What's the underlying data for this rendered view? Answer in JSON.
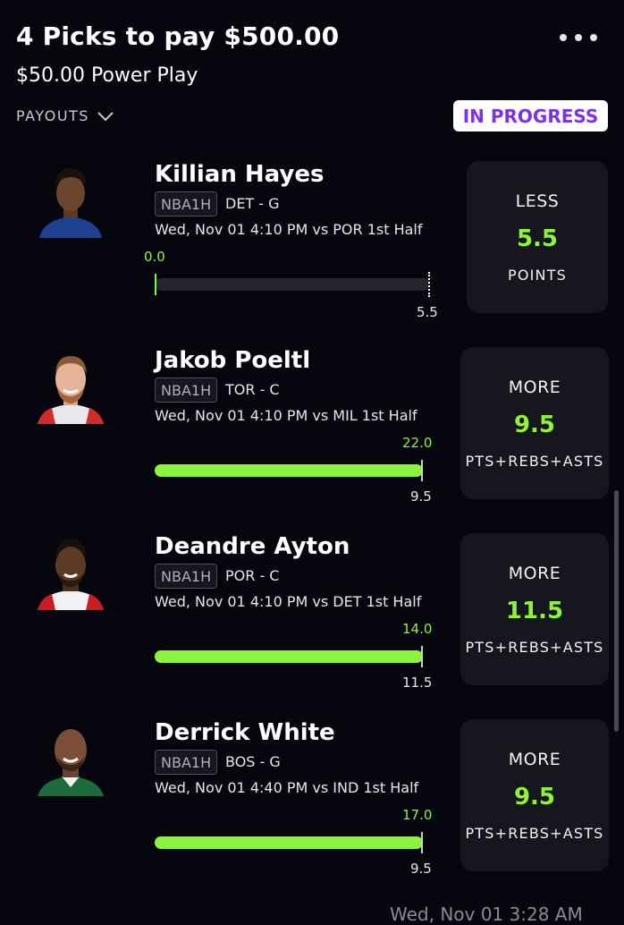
{
  "header": {
    "title": "4 Picks to pay $500.00",
    "subtitle": "$50.00 Power Play",
    "payouts_label": "PAYOUTS",
    "status": "IN PROGRESS"
  },
  "picks": [
    {
      "player": "Killian Hayes",
      "league": "NBA1H",
      "team_pos": "DET - G",
      "game": "Wed, Nov 01 4:10 PM  vs POR 1st Half",
      "current": "0.0",
      "line": "5.5",
      "progress": 0.0,
      "direction": "LESS",
      "stat": "POINTS"
    },
    {
      "player": "Jakob Poeltl",
      "league": "NBA1H",
      "team_pos": "TOR - C",
      "game": "Wed, Nov 01 4:10 PM  vs MIL 1st Half",
      "current": "22.0",
      "line": "9.5",
      "progress": 1.0,
      "direction": "MORE",
      "stat": "PTS+REBS+ASTS"
    },
    {
      "player": "Deandre Ayton",
      "league": "NBA1H",
      "team_pos": "POR - C",
      "game": "Wed, Nov 01 4:10 PM  vs DET 1st Half",
      "current": "14.0",
      "line": "11.5",
      "progress": 1.0,
      "direction": "MORE",
      "stat": "PTS+REBS+ASTS"
    },
    {
      "player": "Derrick White",
      "league": "NBA1H",
      "team_pos": "BOS - G",
      "game": "Wed, Nov 01 4:40 PM  vs IND 1st Half",
      "current": "17.0",
      "line": "9.5",
      "progress": 1.0,
      "direction": "MORE",
      "stat": "PTS+REBS+ASTS"
    }
  ],
  "footer": {
    "timestamp": "Wed, Nov 01 3:28 AM"
  },
  "colors": {
    "accent_green": "#8ef33d",
    "status_purple": "#7a32e8",
    "background": "#06060f",
    "card": "#16161f"
  }
}
